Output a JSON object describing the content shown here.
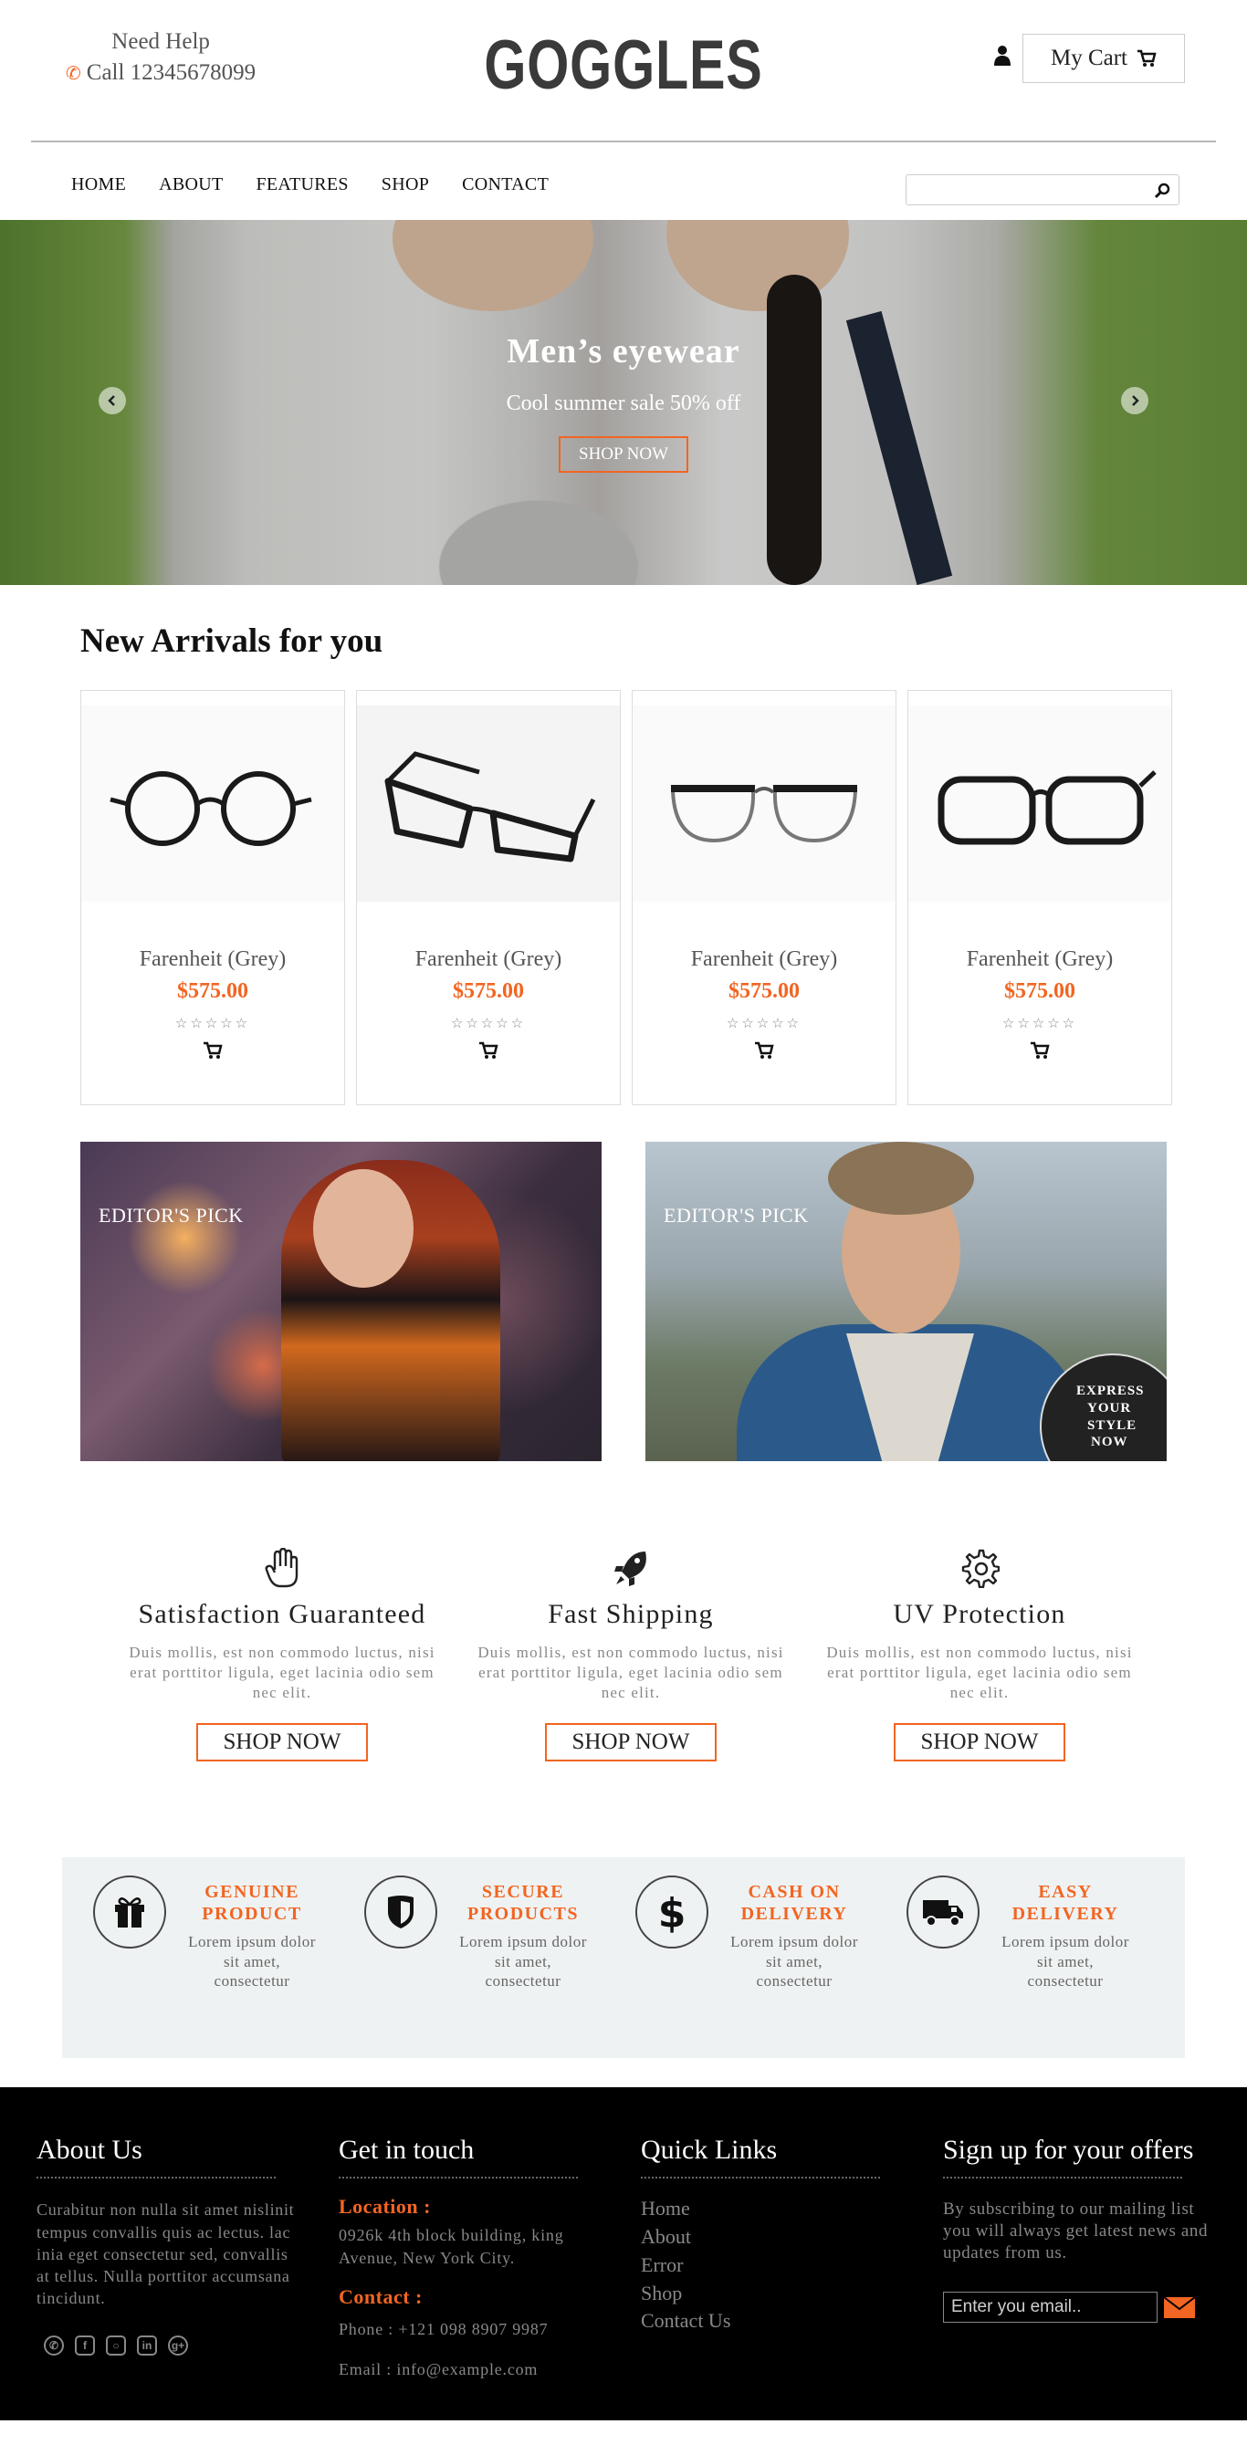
{
  "header": {
    "help_label": "Need Help",
    "phone_label": "Call 12345678099",
    "logo": "GOGGLES",
    "cart_label": "My Cart"
  },
  "nav": {
    "items": [
      "HOME",
      "ABOUT",
      "FEATURES",
      "SHOP",
      "CONTACT"
    ],
    "search_placeholder": ""
  },
  "banner": {
    "title": "Men’s eyewear",
    "subtitle": "Cool summer sale 50% off",
    "button": "SHOP NOW"
  },
  "arrivals": {
    "title": "New Arrivals for you",
    "products": [
      {
        "name": "Farenheit (Grey)",
        "price": "$575.00",
        "stars": "☆☆☆☆☆"
      },
      {
        "name": "Farenheit (Grey)",
        "price": "$575.00",
        "stars": "☆☆☆☆☆"
      },
      {
        "name": "Farenheit (Grey)",
        "price": "$575.00",
        "stars": "☆☆☆☆☆"
      },
      {
        "name": "Farenheit (Grey)",
        "price": "$575.00",
        "stars": "☆☆☆☆☆"
      }
    ]
  },
  "picks": {
    "label_left": "EDITOR'S PICK",
    "label_right": "EDITOR'S PICK",
    "badge_lines": [
      "EXPRESS",
      "YOUR",
      "STYLE",
      "NOW"
    ]
  },
  "features": [
    {
      "icon": "hand-icon",
      "title": "Satisfaction Guaranteed",
      "desc": "Duis mollis, est non commodo luctus, nisi erat porttitor ligula, eget lacinia odio sem nec elit.",
      "button": "SHOP NOW"
    },
    {
      "icon": "rocket-icon",
      "title": "Fast Shipping",
      "desc": "Duis mollis, est non commodo luctus, nisi erat porttitor ligula, eget lacinia odio sem nec elit.",
      "button": "SHOP NOW"
    },
    {
      "icon": "gear-icon",
      "title": "UV Protection",
      "desc": "Duis mollis, est non commodo luctus, nisi erat porttitor ligula, eget lacinia odio sem nec elit.",
      "button": "SHOP NOW"
    }
  ],
  "strip": [
    {
      "icon": "gift-icon",
      "title_lines": [
        "GENUINE",
        "PRODUCT"
      ],
      "desc": "Lorem ipsum dolor sit amet, consectetur"
    },
    {
      "icon": "shield-icon",
      "title_lines": [
        "SECURE",
        "PRODUCTS"
      ],
      "desc": "Lorem ipsum dolor sit amet, consectetur"
    },
    {
      "icon": "dollar-icon",
      "title_lines": [
        "CASH ON",
        "DELIVERY"
      ],
      "desc": "Lorem ipsum dolor sit amet, consectetur"
    },
    {
      "icon": "truck-icon",
      "title_lines": [
        "EASY",
        "DELIVERY"
      ],
      "desc": "Lorem ipsum dolor sit amet, consectetur"
    }
  ],
  "footer": {
    "about_title": "About Us",
    "about_text": "Curabitur non nulla sit amet nislinit tempus convallis quis ac lectus. lac inia eget consectetur sed, convallis at tellus. Nulla porttitor accumsana tincidunt.",
    "touch_title": "Get in touch",
    "location_label": "Location :",
    "location_text": "0926k 4th block building, king Avenue, New York City.",
    "contact_label": "Contact :",
    "phone_text": "Phone : +121 098 8907 9987",
    "email_text": "Email : info@example.com",
    "links_title": "Quick Links",
    "links": [
      "Home",
      "About",
      "Error",
      "Shop",
      "Contact Us"
    ],
    "signup_title": "Sign up for your offers",
    "signup_text": "By subscribing to our mailing list you will always get latest news and updates from us.",
    "email_placeholder": "Enter you email.."
  },
  "colors": {
    "accent": "#f26522",
    "strip_bg": "#eff2f2",
    "footer_bg": "#000000"
  }
}
